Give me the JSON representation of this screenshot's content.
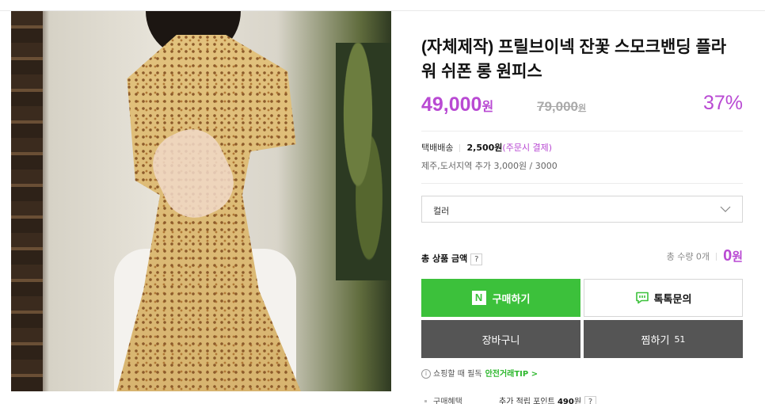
{
  "product": {
    "title": "(자체제작) 프릴브이넥 잔꽃 스모크밴딩 플라워 쉬폰 롱 원피스",
    "price": "49,000",
    "price_unit": "원",
    "original_price": "79,000",
    "original_unit": "원",
    "discount": "37%"
  },
  "shipping": {
    "label": "택배배송",
    "fee": "2,500원",
    "condition": "(주문시 결제)",
    "extra": "제주,도서지역 추가 3,000원 / 3000"
  },
  "option": {
    "placeholder": "컬러"
  },
  "total": {
    "label": "총 상품 금액",
    "help": "?",
    "quantity": "총 수량 0개",
    "amount": "0",
    "unit": "원"
  },
  "buttons": {
    "buy": "구매하기",
    "npay_mark": "N",
    "talk": "톡톡문의",
    "cart": "장바구니",
    "wish": "찜하기",
    "wish_count": "51"
  },
  "tip": {
    "icon": "i",
    "text": "쇼핑할 때 필독",
    "link": "안전거래TIP >"
  },
  "benefit": {
    "label": "구매혜택",
    "text_prefix": "추가 적립 포인트",
    "points": "490",
    "unit": "원",
    "help": "?"
  },
  "colors": {
    "accent": "#b94ad3",
    "npay_green": "#3cc13b",
    "dark_button": "#555555"
  }
}
